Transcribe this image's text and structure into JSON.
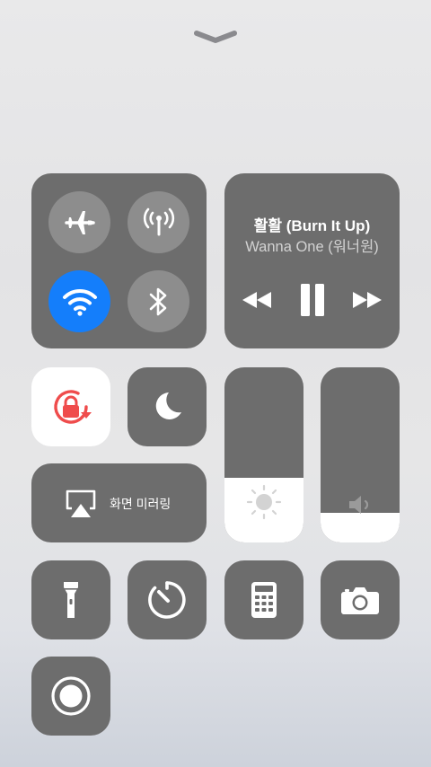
{
  "connectivity": {
    "airplane_icon": "airplane-icon",
    "cellular_icon": "cellular-data-icon",
    "wifi_icon": "wifi-icon",
    "bluetooth_icon": "bluetooth-icon",
    "wifi_active_color": "#147efb"
  },
  "now_playing": {
    "title": "활활 (Burn It Up)",
    "artist": "Wanna One (워너원)"
  },
  "screen_mirroring": {
    "label": "화면 미러링"
  },
  "brightness": {
    "level": 0.37
  },
  "volume": {
    "level": 0.17
  },
  "colors": {
    "tile": "#6d6d6d",
    "round_button": "#8d8d8d",
    "rotation_lock": "#ef4c4c"
  },
  "bottom_controls": [
    "flashlight-icon",
    "timer-icon",
    "calculator-icon",
    "camera-icon",
    "screen-record-icon"
  ]
}
